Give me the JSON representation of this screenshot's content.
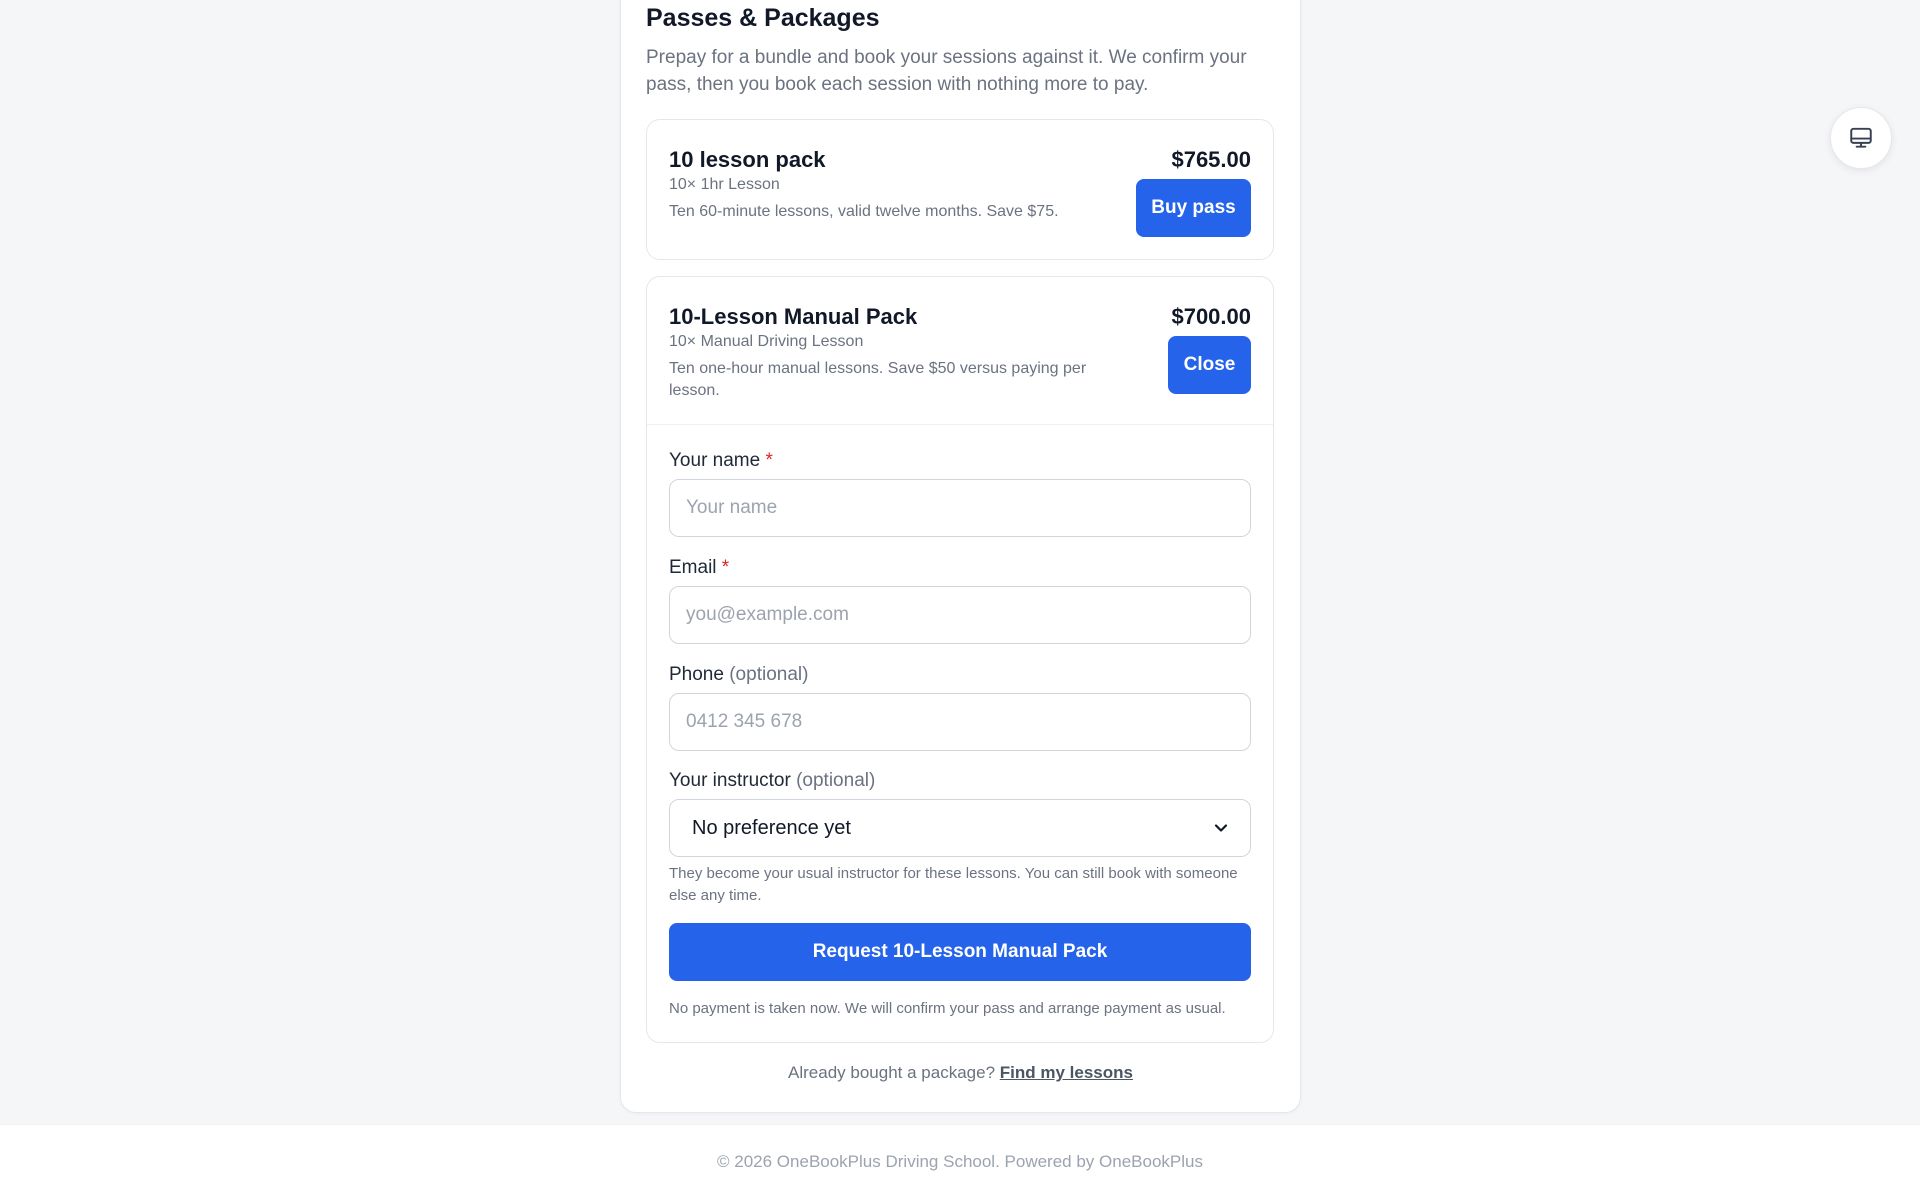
{
  "section": {
    "title": "Passes & Packages",
    "description": "Prepay for a bundle and book your sessions against it. We confirm your pass, then you book each session with nothing more to pay."
  },
  "packages": [
    {
      "name": "10 lesson pack",
      "subtitle": "10× 1hr Lesson",
      "description": "Ten 60-minute lessons, valid twelve months. Save $75.",
      "price": "$765.00",
      "button": "Buy pass"
    },
    {
      "name": "10-Lesson Manual Pack",
      "subtitle": "10× Manual Driving Lesson",
      "description": "Ten one-hour manual lessons. Save $50 versus paying per lesson.",
      "price": "$700.00",
      "button": "Close"
    }
  ],
  "form": {
    "name": {
      "label": "Your name",
      "required_mark": "*",
      "placeholder": "Your name"
    },
    "email": {
      "label": "Email",
      "required_mark": "*",
      "placeholder": "you@example.com"
    },
    "phone": {
      "label": "Phone",
      "optional_text": "(optional)",
      "placeholder": "0412 345 678"
    },
    "instructor": {
      "label": "Your instructor",
      "optional_text": "(optional)",
      "selected": "No preference yet",
      "help": "They become your usual instructor for these lessons. You can still book with someone else any time."
    },
    "submit_label": "Request 10-Lesson Manual Pack",
    "note": "No payment is taken now. We will confirm your pass and arrange payment as usual."
  },
  "footer_note": {
    "text": "Already bought a package?",
    "link": "Find my lessons"
  },
  "copyright": "© 2026 OneBookPlus Driving School. Powered by OneBookPlus",
  "colors": {
    "accent": "#2563eb",
    "required": "#dc2626"
  },
  "icons": {
    "floating": "monitor-icon",
    "select": "chevron-down-icon"
  }
}
